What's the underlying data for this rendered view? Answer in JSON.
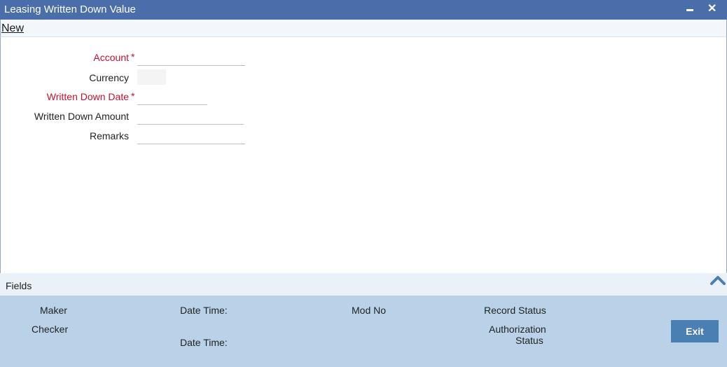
{
  "window": {
    "title": "Leasing Written Down Value",
    "minimize_icon": "minimize-icon",
    "close_icon": "close-icon"
  },
  "toolbar": {
    "new_label": "New"
  },
  "form": {
    "account_label": "Account",
    "currency_label": "Currency",
    "written_down_date_label": "Written Down Date",
    "written_down_amount_label": "Written Down Amount",
    "remarks_label": "Remarks",
    "required_marker": "*",
    "account_value": "",
    "currency_value": "",
    "written_down_date_value": "",
    "written_down_amount_value": "",
    "remarks_value": ""
  },
  "fields_section": {
    "label": "Fields",
    "toggle_icon": "chevron-up-icon"
  },
  "audit": {
    "maker": "Maker",
    "checker": "Checker",
    "date_time_1": "Date Time:",
    "date_time_2": "Date Time:",
    "mod_no": "Mod No",
    "record_status": "Record Status",
    "authorization": "Authorization",
    "status": "Status",
    "exit_label": "Exit"
  },
  "colors": {
    "titlebar": "#4a6ea9",
    "required": "#c8102e",
    "audit_bg": "#b9d2e8",
    "exit_button": "#4a7fb4"
  }
}
